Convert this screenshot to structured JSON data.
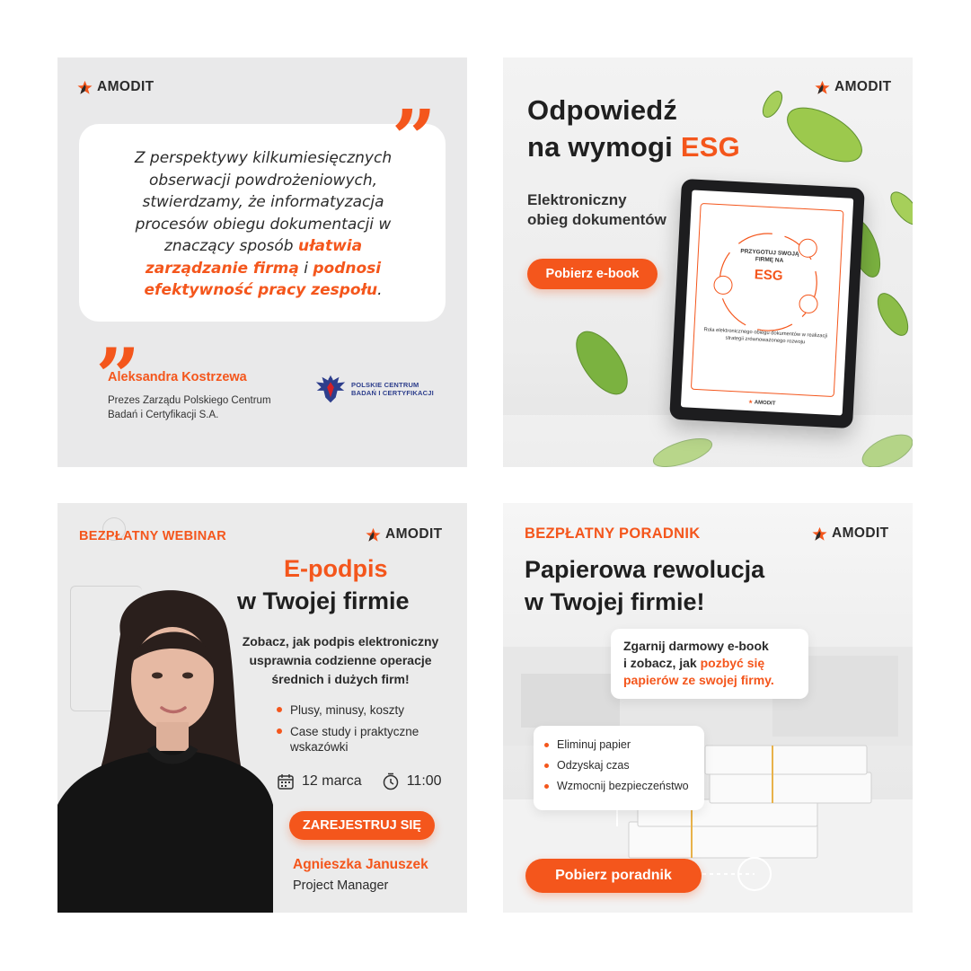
{
  "brand": {
    "name": "AMODIT",
    "accent": "#f4561c"
  },
  "quote_panel": {
    "quote_parts": [
      {
        "text": "Z perspektywy kilkumiesięcznych obserwacji powdrożeniowych, stwierdzamy, że informatyzacja procesów obiegu dokumentacji w znaczący sposób ",
        "highlight": false
      },
      {
        "text": "ułatwia zarządzanie firmą",
        "highlight": true
      },
      {
        "text": " i ",
        "highlight": false
      },
      {
        "text": "podnosi efektywność pracy zespołu",
        "highlight": true
      },
      {
        "text": ".",
        "highlight": false
      }
    ],
    "author_name": "Aleksandra Kostrzewa",
    "author_role": "Prezes Zarządu Polskiego Centrum Badań i Certyfikacji S.A.",
    "partner_logo_line1": "POLSKIE CENTRUM",
    "partner_logo_line2": "BADAŃ I CERTYFIKACJI"
  },
  "esg_panel": {
    "title_line1": "Odpowiedź",
    "title_line2_prefix": "na wymogi ",
    "title_line2_accent": "ESG",
    "subtitle_line1": "Elektroniczny",
    "subtitle_line2": "obieg dokumentów",
    "button_label": "Pobierz e-book",
    "tablet": {
      "heading_line1": "PRZYGOTUJ SWOJĄ",
      "heading_line2": "FIRMĘ NA",
      "accent": "ESG",
      "footer": "Rola elektronicznego obiegu dokumentów w realizacji strategii zrównoważonego rozwoju",
      "logo": "AMODIT"
    }
  },
  "webinar_panel": {
    "tag": "BEZPŁATNY WEBINAR",
    "title_accent": "E-podpis",
    "title_rest": "w Twojej firmie",
    "description": "Zobacz, jak podpis elektroniczny usprawnia codzienne operacje średnich i dużych firm!",
    "bullets": [
      "Plusy, minusy, koszty",
      "Case study i praktyczne wskazówki"
    ],
    "date": "12 marca",
    "time": "11:00",
    "button_label": "ZAREJESTRUJ SIĘ",
    "speaker_name": "Agnieszka Januszek",
    "speaker_role": "Project Manager"
  },
  "guide_panel": {
    "tag": "BEZPŁATNY PORADNIK",
    "title_line1": "Papierowa rewolucja",
    "title_line2": "w Twojej firmie!",
    "card_line1": "Zgarnij darmowy e-book",
    "card_line2_prefix": "i zobacz, jak ",
    "card_line2_accent": "pozbyć się",
    "card_line3_accent": "papierów ze swojej firmy.",
    "bullets": [
      "Eliminuj papier",
      "Odzyskaj czas",
      "Wzmocnij bezpieczeństwo"
    ],
    "button_label": "Pobierz poradnik"
  }
}
